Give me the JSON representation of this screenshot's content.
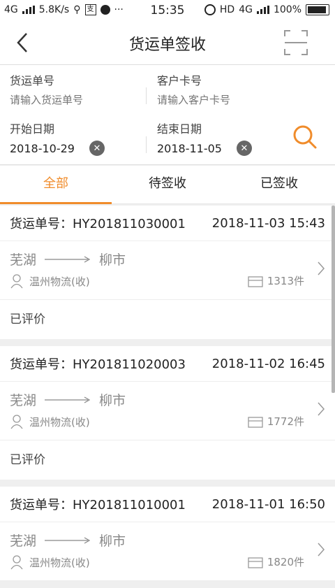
{
  "status_bar": {
    "network": "4G",
    "speed": "5.8K/s",
    "time": "15:35",
    "hd": "HD",
    "network_right": "4G",
    "battery": "100%"
  },
  "header": {
    "title": "货运单签收"
  },
  "filters": {
    "waybill_label": "货运单号",
    "waybill_placeholder": "请输入货运单号",
    "customer_label": "客户卡号",
    "customer_placeholder": "请输入客户卡号",
    "start_label": "开始日期",
    "start_value": "2018-10-29",
    "end_label": "结束日期",
    "end_value": "2018-11-05"
  },
  "tabs": [
    {
      "label": "全部"
    },
    {
      "label": "待签收"
    },
    {
      "label": "已签收"
    }
  ],
  "orders": [
    {
      "number_label": "货运单号：",
      "number": "HY201811030001",
      "datetime": "2018-11-03 15:43",
      "from": "芜湖",
      "to": "柳市",
      "carrier": "温州物流(收)",
      "quantity": "1313件",
      "status": "已评价"
    },
    {
      "number_label": "货运单号：",
      "number": "HY201811020003",
      "datetime": "2018-11-02 16:45",
      "from": "芜湖",
      "to": "柳市",
      "carrier": "温州物流(收)",
      "quantity": "1772件",
      "status": "已评价"
    },
    {
      "number_label": "货运单号：",
      "number": "HY201811010001",
      "datetime": "2018-11-01 16:50",
      "from": "芜湖",
      "to": "柳市",
      "carrier": "温州物流(收)",
      "quantity": "1820件",
      "status": ""
    }
  ],
  "colors": {
    "accent": "#f08c2b",
    "muted": "#888888"
  }
}
